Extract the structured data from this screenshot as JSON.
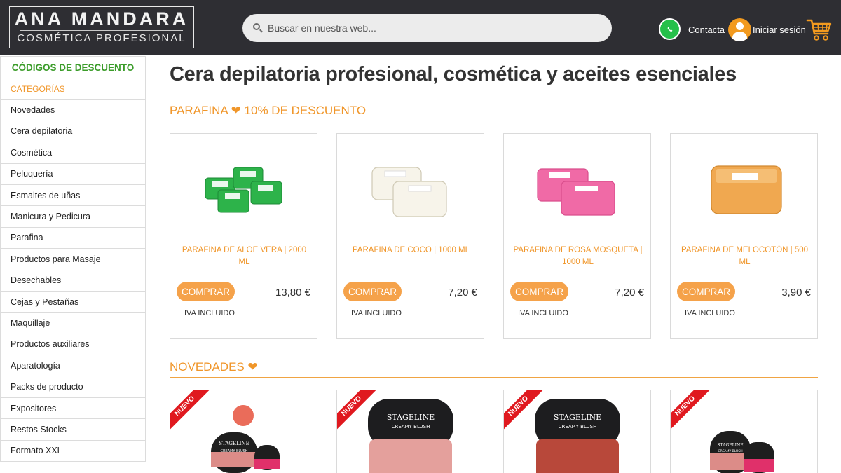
{
  "header": {
    "logo_title": "ANA MANDARA",
    "logo_subtitle": "COSMÉTICA PROFESIONAL",
    "search_placeholder": "Buscar en nuestra web...",
    "contact_label": "Contacta",
    "login_label": "Iniciar sesión",
    "icons": [
      "search-icon",
      "whatsapp-icon",
      "user-icon",
      "cart-icon"
    ]
  },
  "sidebar": {
    "discount_codes": "CÓDIGOS DE DESCUENTO",
    "categories_heading": "CATEGORÍAS",
    "items": [
      "Novedades",
      "Cera depilatoria",
      "Cosmética",
      "Peluquería",
      "Esmaltes de uñas",
      "Manicura y Pedicura",
      "Parafina",
      "Productos para Masaje",
      "Desechables",
      "Cejas y Pestañas",
      "Maquillaje",
      "Productos auxiliares",
      "Aparatología",
      "Packs de producto",
      "Expositores",
      "Restos Stocks",
      "Formato XXL"
    ]
  },
  "main": {
    "title": "Cera depilatoria profesional, cosmética y aceites esenciales",
    "section1_heading": "PARAFINA",
    "section1_heading_suffix": "10% DE DESCUENTO",
    "heart_glyph": "❤",
    "products": [
      {
        "name": "PARAFINA DE ALOE VERA | 2000 ML",
        "price": "13,80 €",
        "buy_label": "COMPRAR",
        "tax_note": "IVA INCLUIDO",
        "color": "#2db34a"
      },
      {
        "name": "PARAFINA DE COCO | 1000 ML",
        "price": "7,20 €",
        "buy_label": "COMPRAR",
        "tax_note": "IVA INCLUIDO",
        "color": "#f3efe0"
      },
      {
        "name": "PARAFINA DE ROSA MOSQUETA | 1000 ML",
        "price": "7,20 €",
        "buy_label": "COMPRAR",
        "tax_note": "IVA INCLUIDO",
        "color": "#f06aa6"
      },
      {
        "name": "PARAFINA DE MELOCOTÓN | 500 ML",
        "price": "3,90 €",
        "buy_label": "COMPRAR",
        "tax_note": "IVA INCLUIDO",
        "color": "#f0a850"
      }
    ],
    "section2_heading": "NOVEDADES",
    "new_badge": "NUEVO",
    "new_products": [
      {
        "brand": "STAGELINE",
        "product_label": "CREAMY BLUSH",
        "color": "#ea6c5a"
      },
      {
        "brand": "STAGELINE",
        "product_label": "CREAMY BLUSH",
        "color": "#e4a09c"
      },
      {
        "brand": "STAGELINE",
        "product_label": "CREAMY BLUSH",
        "color": "#b8483a"
      },
      {
        "brand": "STAGELINE",
        "product_label": "CREAMY BLUSH",
        "color": "#e0306a"
      }
    ]
  },
  "colors": {
    "header_bg": "#2e2e33",
    "accent_orange": "#f0962a",
    "discount_green": "#3b9c2a",
    "new_badge_red": "#e0191f"
  }
}
